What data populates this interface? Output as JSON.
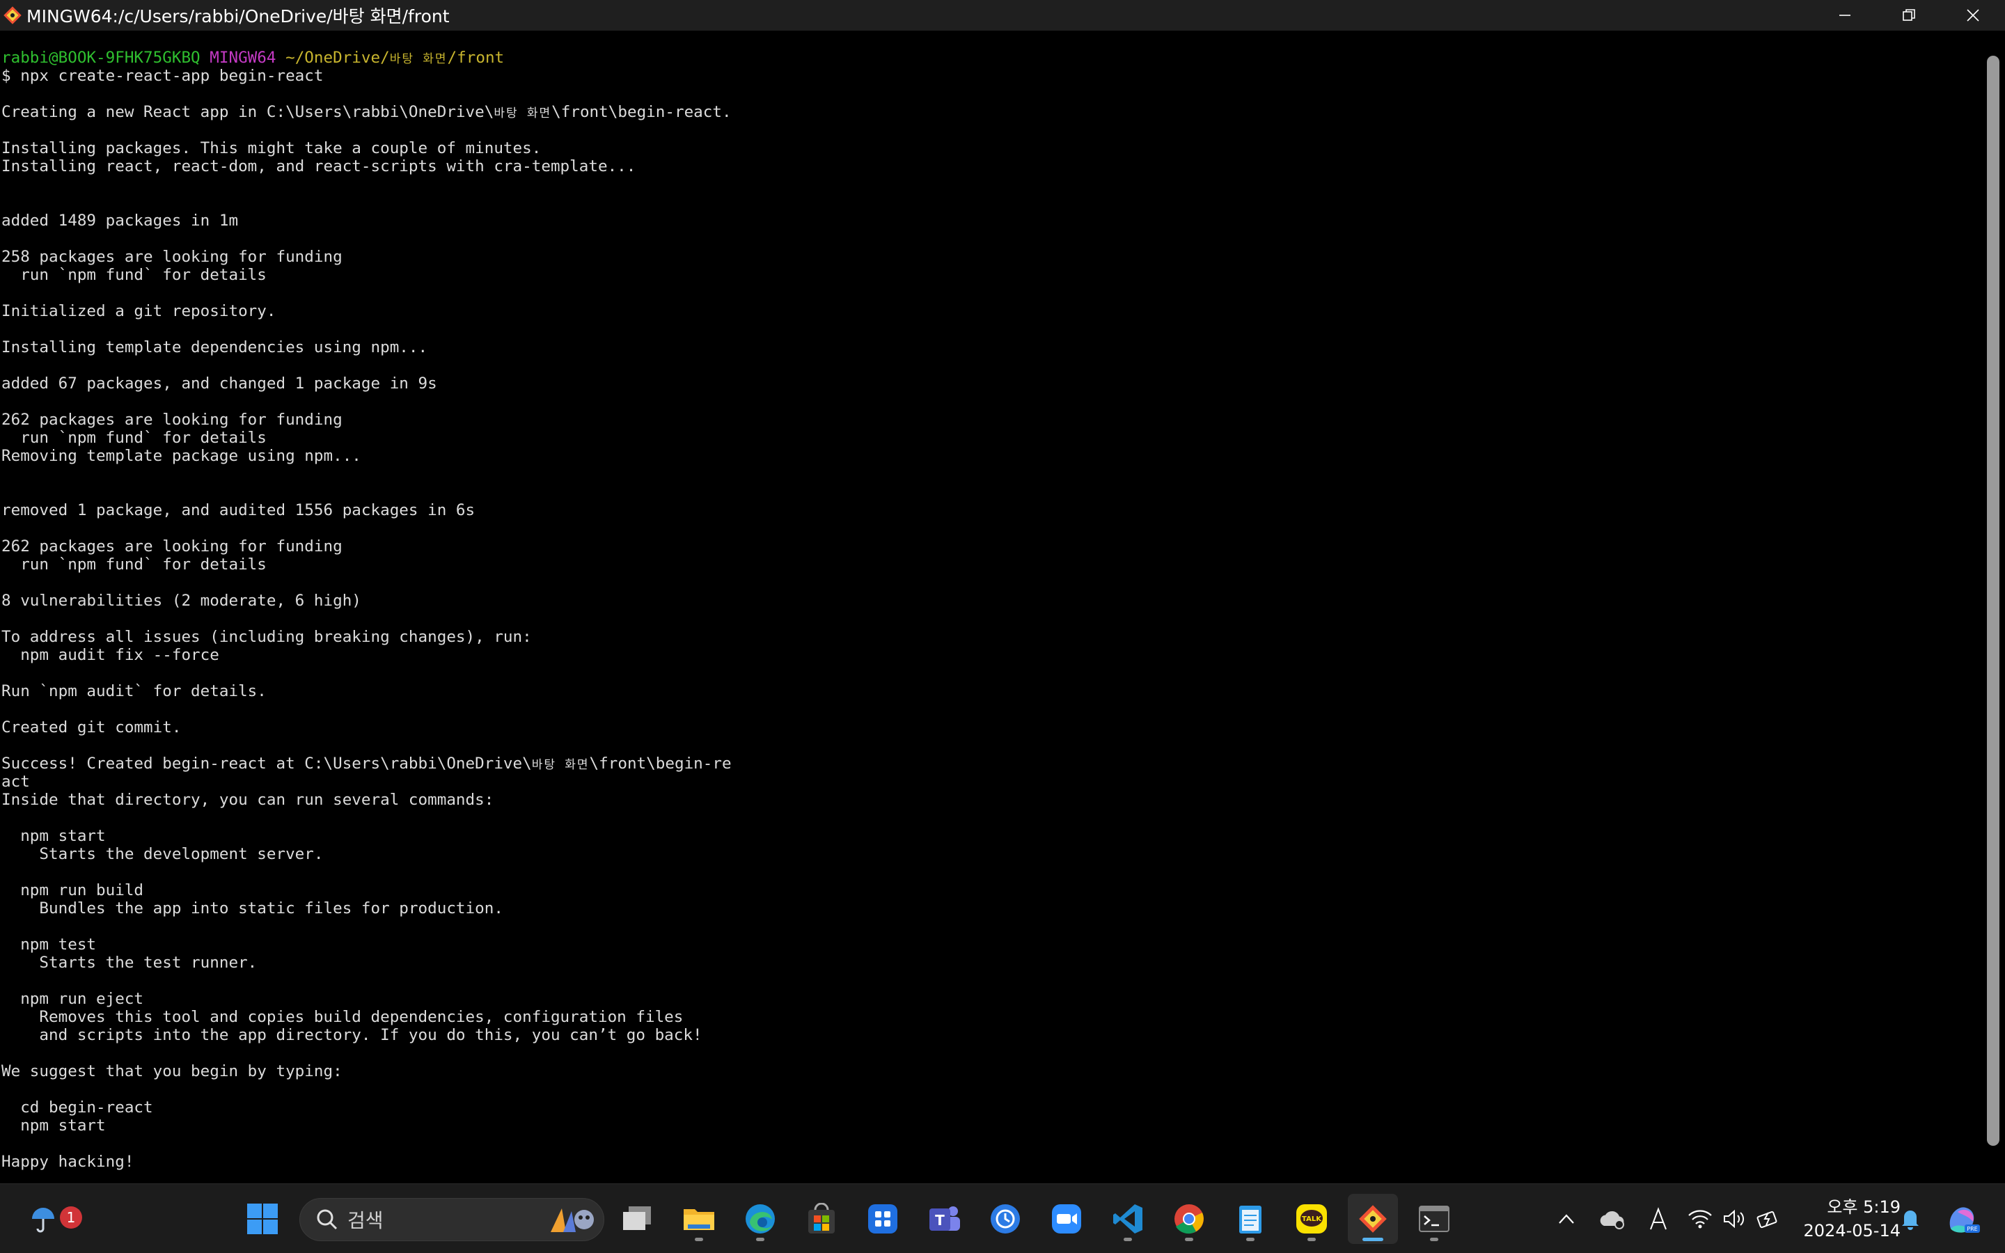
{
  "window": {
    "title": "MINGW64:/c/Users/rabbi/OneDrive/바탕 화면/front",
    "icon": "git-bash-icon",
    "controls": [
      "minimize-icon",
      "restore-icon",
      "close-icon"
    ]
  },
  "terminal": {
    "prompt": {
      "user_host": "rabbi@BOOK-9FHK75GKBQ",
      "env": "MINGW64",
      "path_prefix": "~/OneDrive/",
      "path_hangul": "바탕 화면",
      "path_suffix": "/front"
    },
    "command": "$ npx create-react-app begin-react",
    "line_creating_a": "Creating a new React app in C:\\Users\\rabbi\\OneDrive\\",
    "line_creating_hangul": "바탕 화면",
    "line_creating_b": "\\front\\begin-react.",
    "lines_a": [
      "",
      "Installing packages. This might take a couple of minutes.",
      "Installing react, react-dom, and react-scripts with cra-template...",
      "",
      "",
      "added 1489 packages in 1m",
      "",
      "258 packages are looking for funding",
      "  run `npm fund` for details",
      "",
      "Initialized a git repository.",
      "",
      "Installing template dependencies using npm...",
      "",
      "added 67 packages, and changed 1 package in 9s",
      "",
      "262 packages are looking for funding",
      "  run `npm fund` for details",
      "Removing template package using npm...",
      "",
      "",
      "removed 1 package, and audited 1556 packages in 6s",
      "",
      "262 packages are looking for funding",
      "  run `npm fund` for details",
      "",
      "8 vulnerabilities (2 moderate, 6 high)",
      "",
      "To address all issues (including breaking changes), run:",
      "  npm audit fix --force",
      "",
      "Run `npm audit` for details.",
      "",
      "Created git commit.",
      ""
    ],
    "line_success_a": "Success! Created begin-react at C:\\Users\\rabbi\\OneDrive\\",
    "line_success_hangul": "바탕 화면",
    "line_success_b": "\\front\\begin-re",
    "lines_b": [
      "act",
      "Inside that directory, you can run several commands:",
      "",
      "  npm start",
      "    Starts the development server.",
      "",
      "  npm run build",
      "    Bundles the app into static files for production.",
      "",
      "  npm test",
      "    Starts the test runner.",
      "",
      "  npm run eject",
      "    Removes this tool and copies build dependencies, configuration files",
      "    and scripts into the app directory. If you do this, you can’t go back!",
      "",
      "We suggest that you begin by typing:",
      "",
      "  cd begin-react",
      "  npm start",
      "",
      "Happy hacking!"
    ]
  },
  "taskbar": {
    "weather_badge": "1",
    "search_label": "검색",
    "apps": [
      "windows-start-icon",
      "task-view-icon",
      "file-explorer-icon",
      "edge-icon",
      "microsoft-store-icon",
      "widgets-app-icon",
      "teams-icon",
      "sync-app-icon",
      "zoom-icon",
      "vscode-icon",
      "chrome-icon",
      "notepad-icon",
      "kakaotalk-icon",
      "git-bash-icon",
      "terminal-icon"
    ],
    "kakaotalk_label": "TALK",
    "clock_time": "오후 5:19",
    "clock_date": "2024-05-14"
  },
  "colors": {
    "prompt_green": "#2fbf2f",
    "prompt_magenta": "#c43ac4",
    "prompt_yellow": "#c8b52e",
    "terminal_text": "#dcdcdc",
    "accent_blue": "#58b3f0"
  }
}
